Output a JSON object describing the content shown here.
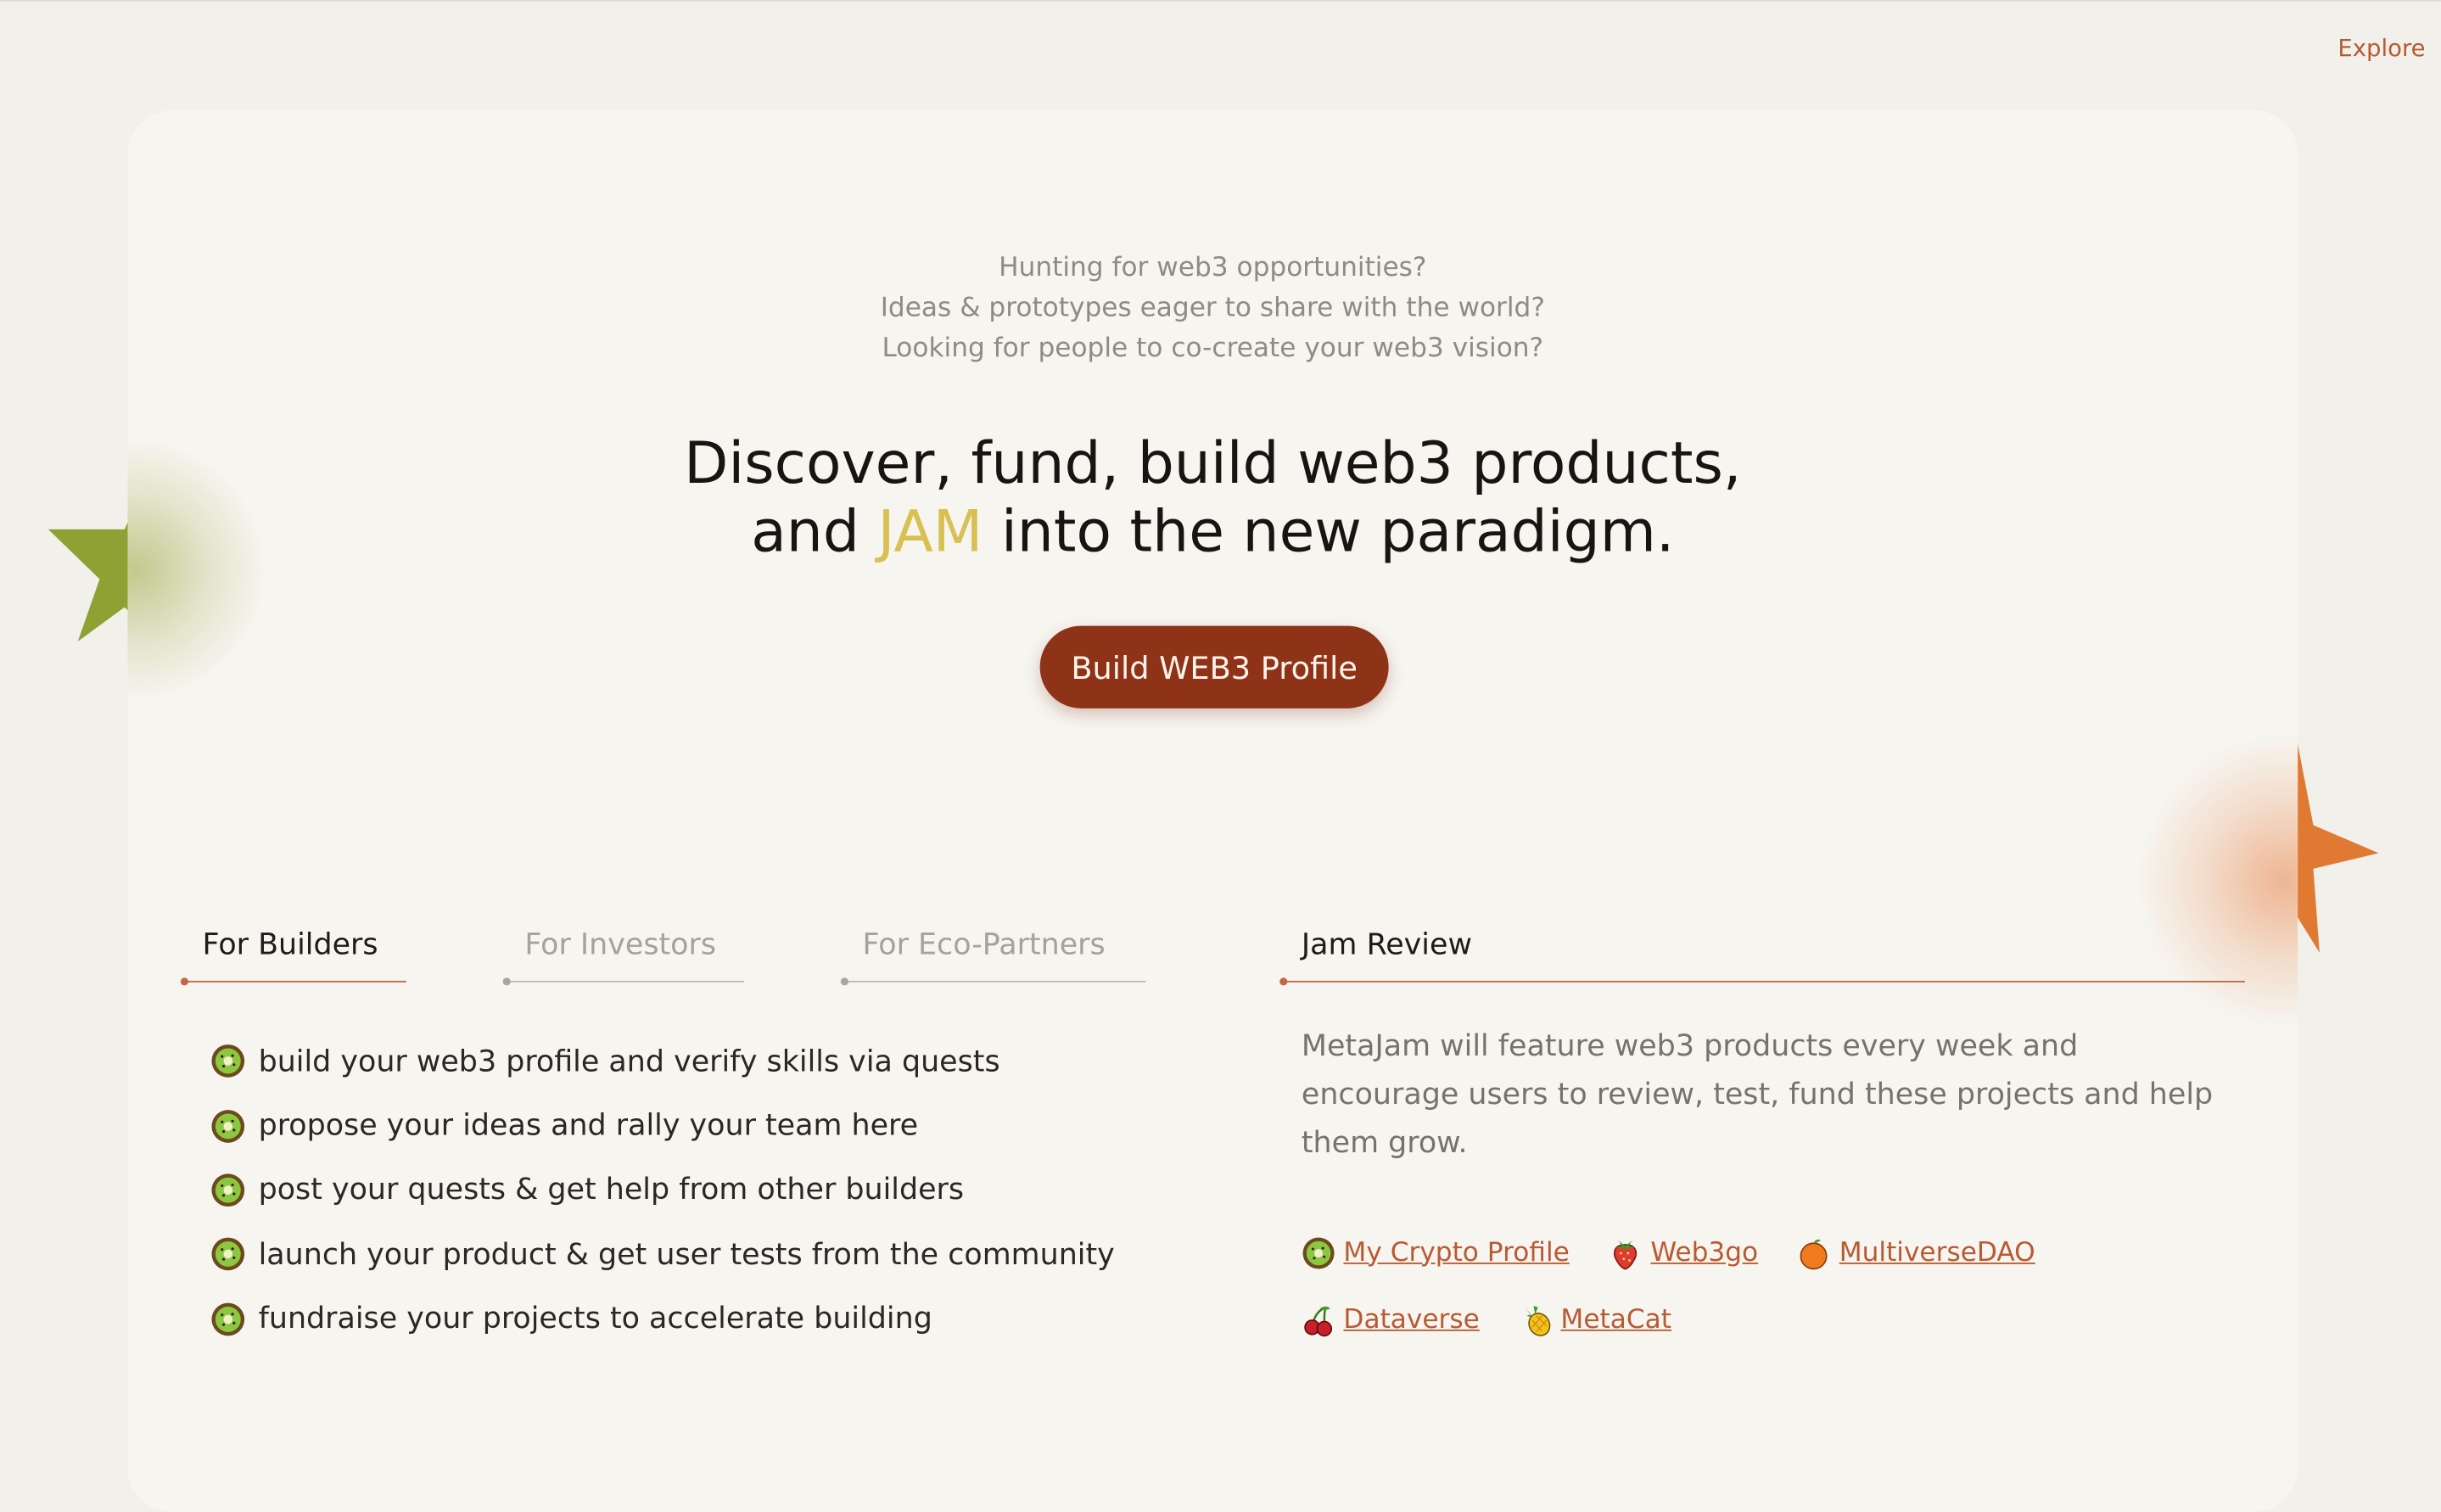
{
  "nav": {
    "explore_label": "Explore"
  },
  "hero": {
    "intro_lines": [
      "Hunting for web3 opportunities?",
      "Ideas & prototypes eager to share with the world?",
      "Looking for people to co-create your web3 vision?"
    ],
    "headline_line1": "Discover, fund, build web3 products,",
    "headline_pre": "and ",
    "headline_highlight": "JAM",
    "headline_post": " into the new paradigm.",
    "cta_label": "Build WEB3 Profile"
  },
  "tabs": [
    {
      "label": "For Builders",
      "active": true
    },
    {
      "label": "For Investors",
      "active": false
    },
    {
      "label": "For Eco-Partners",
      "active": false
    }
  ],
  "builders_list": [
    "build your web3 profile and verify skills via quests",
    "propose your ideas and rally your team here",
    "post your quests & get help from other builders",
    "launch your product & get user tests from the community",
    "fundraise your projects to accelerate building"
  ],
  "jam_review": {
    "title": "Jam Review",
    "description": "MetaJam will feature web3 products every week and encourage users to review, test, fund these projects and help them grow.",
    "links": [
      {
        "label": "My Crypto Profile",
        "icon": "kiwi-icon"
      },
      {
        "label": "Web3go",
        "icon": "strawberry-icon"
      },
      {
        "label": "MultiverseDAO",
        "icon": "orange-icon"
      },
      {
        "label": "Dataverse",
        "icon": "cherries-icon"
      },
      {
        "label": "MetaCat",
        "icon": "pineapple-icon"
      }
    ]
  },
  "colors": {
    "accent": "#8f3318",
    "link": "#b85a34",
    "highlight": "#d8c052",
    "background": "#f2f0eb",
    "card": "#f6f5f0"
  }
}
